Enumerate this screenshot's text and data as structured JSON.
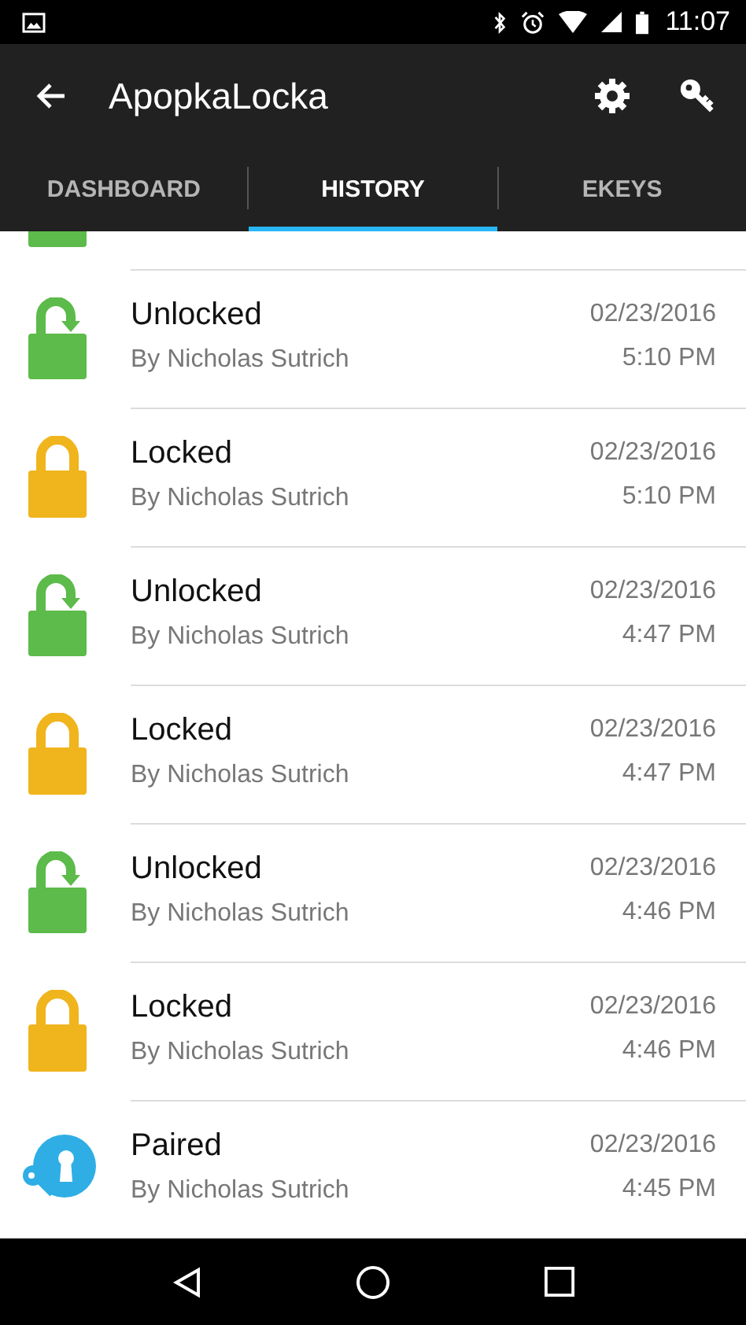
{
  "status_bar": {
    "time": "11:07"
  },
  "app_bar": {
    "title": "ApopkaLocka"
  },
  "tabs": [
    {
      "label": "DASHBOARD",
      "selected": false
    },
    {
      "label": "HISTORY",
      "selected": true
    },
    {
      "label": "EKEYS",
      "selected": false
    }
  ],
  "partial_row": {
    "kind": "unlocked"
  },
  "events": [
    {
      "kind": "unlocked",
      "title": "Unlocked",
      "by": "By Nicholas Sutrich",
      "date": "02/23/2016",
      "time": "5:10 PM"
    },
    {
      "kind": "locked",
      "title": "Locked",
      "by": "By Nicholas Sutrich",
      "date": "02/23/2016",
      "time": "5:10 PM"
    },
    {
      "kind": "unlocked",
      "title": "Unlocked",
      "by": "By Nicholas Sutrich",
      "date": "02/23/2016",
      "time": "4:47 PM"
    },
    {
      "kind": "locked",
      "title": "Locked",
      "by": "By Nicholas Sutrich",
      "date": "02/23/2016",
      "time": "4:47 PM"
    },
    {
      "kind": "unlocked",
      "title": "Unlocked",
      "by": "By Nicholas Sutrich",
      "date": "02/23/2016",
      "time": "4:46 PM"
    },
    {
      "kind": "locked",
      "title": "Locked",
      "by": "By Nicholas Sutrich",
      "date": "02/23/2016",
      "time": "4:46 PM"
    },
    {
      "kind": "paired",
      "title": "Paired",
      "by": "By Nicholas Sutrich",
      "date": "02/23/2016",
      "time": "4:45 PM"
    }
  ]
}
